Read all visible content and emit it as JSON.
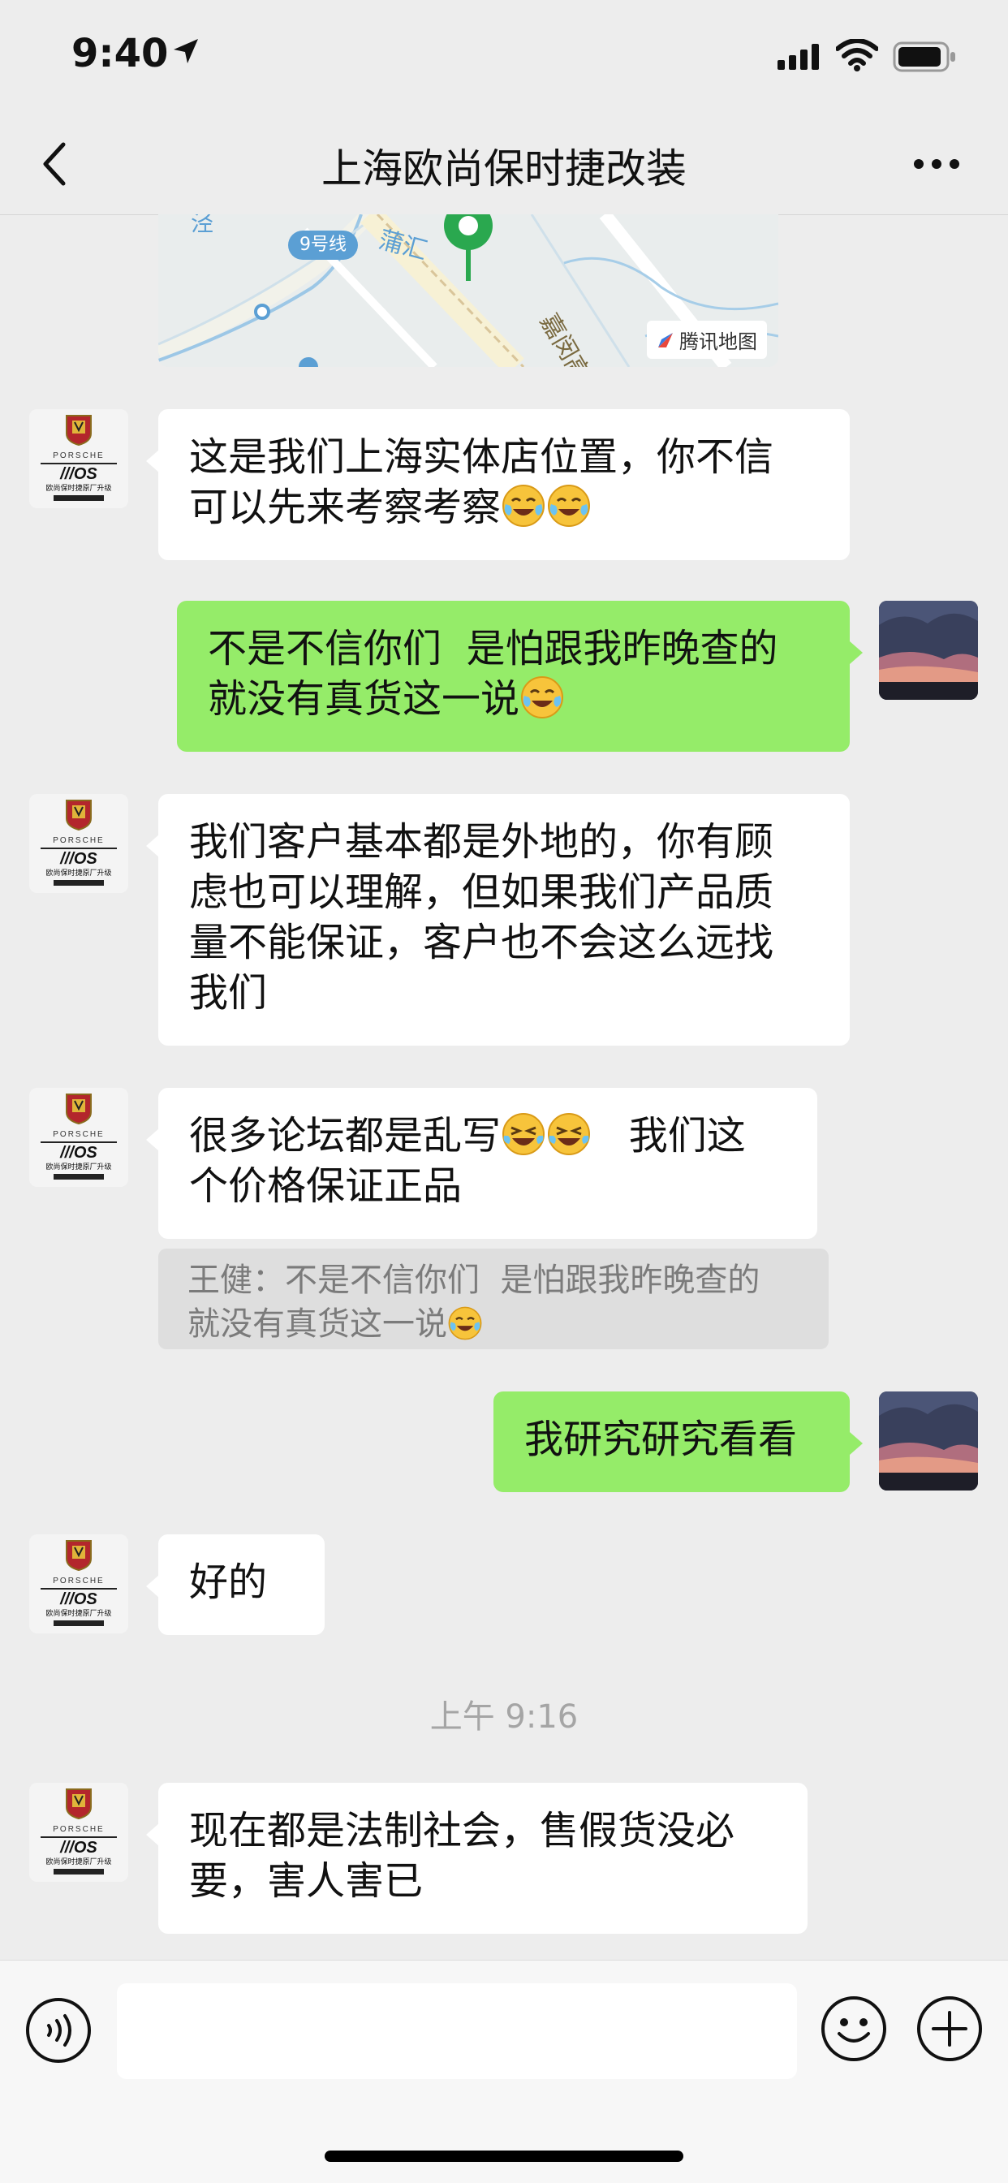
{
  "status_bar": {
    "time": "9:40"
  },
  "header": {
    "title": "上海欧尚保时捷改装"
  },
  "map": {
    "brand": "腾讯地图",
    "line_label": "9号线"
  },
  "messages": [
    {
      "side": "in",
      "text": "这是我们上海实体店位置，你不信\n可以先来考察考察",
      "emoji": "😭😭"
    },
    {
      "side": "out",
      "text": "不是不信你们  是怕跟我昨晚查的\n就没有真货这一说",
      "emoji": "😭"
    },
    {
      "side": "in",
      "text": "我们客户基本都是外地的，你有顾\n虑也可以理解，但如果我们产品质\n量不能保证，客户也不会这么远找\n我们"
    },
    {
      "side": "in",
      "text_a": "很多论坛都是乱写",
      "text_b": "   我们这\n个价格保证正品",
      "emoji": "😂😂",
      "quote": {
        "text": "王健：不是不信你们  是怕跟我昨晚查的\n就没有真货这一说",
        "emoji": "😭"
      }
    },
    {
      "side": "out",
      "text": "我研究研究看看"
    },
    {
      "side": "in",
      "text": "好的"
    },
    {
      "side": "in",
      "text": "现在都是法制社会，售假货没必\n要，害人害已"
    }
  ],
  "timestamp": "上午 9:16",
  "input": {
    "placeholder": ""
  },
  "avatar_logo": {
    "brand": "PORSCHE",
    "tag": "OS",
    "subtitle": "欧尚保时捷原厂升级"
  },
  "colors": {
    "outgoing_bubble": "#95ec69",
    "incoming_bubble": "#ffffff",
    "background": "#ededed"
  }
}
